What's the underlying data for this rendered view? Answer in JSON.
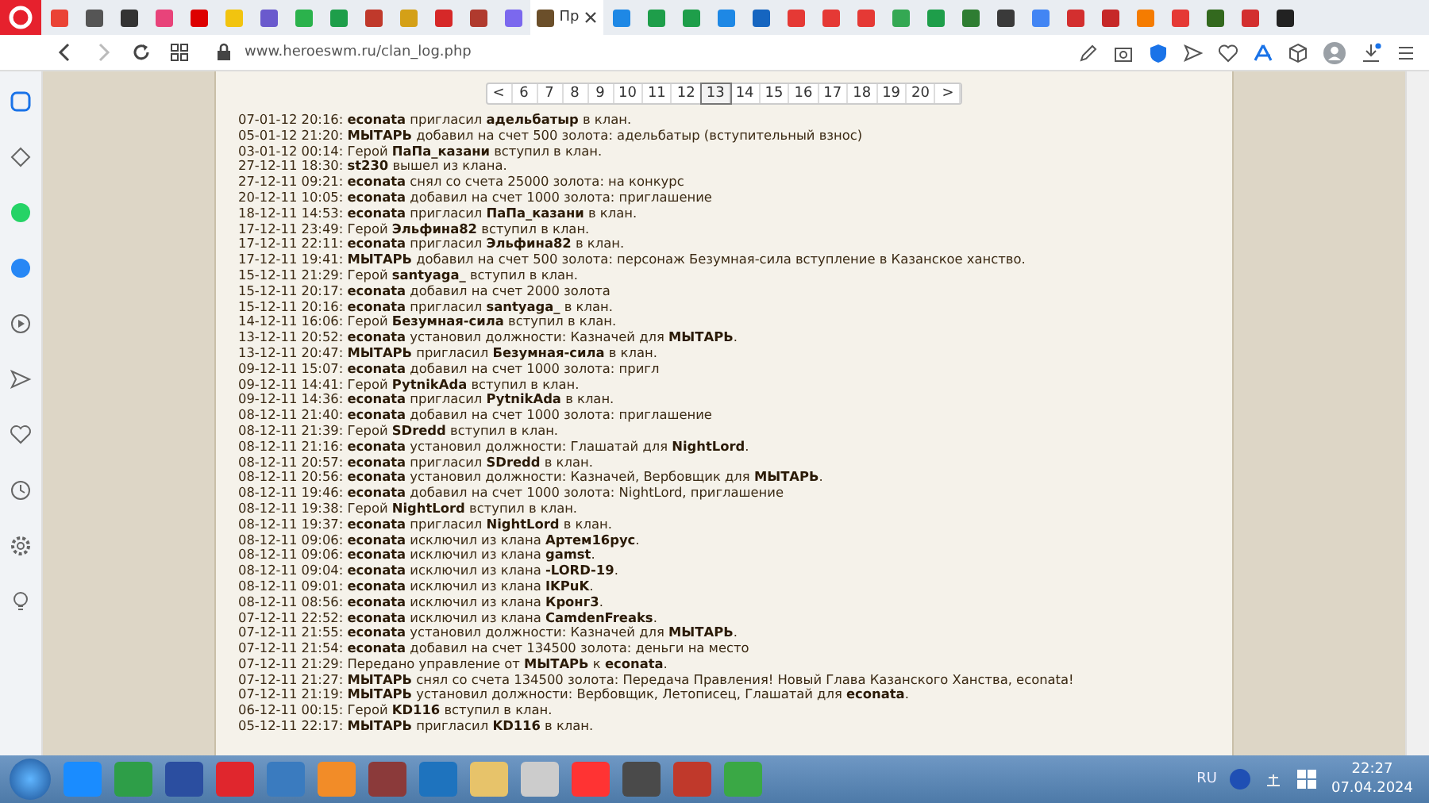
{
  "browser_tabs": [
    {
      "color": "#ea4335",
      "selected": false
    },
    {
      "color": "#555555",
      "selected": false
    },
    {
      "color": "#333333",
      "selected": false
    },
    {
      "color": "#e8437a",
      "selected": false
    },
    {
      "color": "#dd0000",
      "selected": false
    },
    {
      "color": "#f2c40f",
      "selected": false
    },
    {
      "color": "#6a5acd",
      "selected": false
    },
    {
      "color": "#2bb24c",
      "selected": false
    },
    {
      "color": "#1e9e4a",
      "selected": false
    },
    {
      "color": "#c0392b",
      "selected": false
    },
    {
      "color": "#d4a017",
      "selected": false
    },
    {
      "color": "#d62828",
      "selected": false
    },
    {
      "color": "#b03a2e",
      "selected": false
    },
    {
      "color": "#7b68ee",
      "selected": false
    },
    {
      "color": "#6b4f2a",
      "selected": true,
      "title": "Пр"
    },
    {
      "color": "#1e88e5",
      "selected": false
    },
    {
      "color": "#1e9e4a",
      "selected": false
    },
    {
      "color": "#1e9e4a",
      "selected": false
    },
    {
      "color": "#1e88e5",
      "selected": false
    },
    {
      "color": "#1565c0",
      "selected": false
    },
    {
      "color": "#e53935",
      "selected": false
    },
    {
      "color": "#e53935",
      "selected": false
    },
    {
      "color": "#e53935",
      "selected": false
    },
    {
      "color": "#34a853",
      "selected": false
    },
    {
      "color": "#1e9e4a",
      "selected": false
    },
    {
      "color": "#2e7d32",
      "selected": false
    },
    {
      "color": "#3a3a3a",
      "selected": false
    },
    {
      "color": "#4285f4",
      "selected": false
    },
    {
      "color": "#d32f2f",
      "selected": false
    },
    {
      "color": "#c62828",
      "selected": false
    },
    {
      "color": "#f57c00",
      "selected": false
    },
    {
      "color": "#e53935",
      "selected": false
    },
    {
      "color": "#33691e",
      "selected": false
    },
    {
      "color": "#d32f2f",
      "selected": false
    },
    {
      "color": "#222222",
      "selected": false
    }
  ],
  "address_bar": {
    "url": "www.heroeswm.ru/clan_log.php"
  },
  "pagination": [
    {
      "label": "<",
      "selected": false
    },
    {
      "label": "6",
      "selected": false
    },
    {
      "label": "7",
      "selected": false
    },
    {
      "label": "8",
      "selected": false
    },
    {
      "label": "9",
      "selected": false
    },
    {
      "label": "10",
      "selected": false
    },
    {
      "label": "11",
      "selected": false
    },
    {
      "label": "12",
      "selected": false
    },
    {
      "label": "13",
      "selected": true
    },
    {
      "label": "14",
      "selected": false
    },
    {
      "label": "15",
      "selected": false
    },
    {
      "label": "16",
      "selected": false
    },
    {
      "label": "17",
      "selected": false
    },
    {
      "label": "18",
      "selected": false
    },
    {
      "label": "19",
      "selected": false
    },
    {
      "label": "20",
      "selected": false
    },
    {
      "label": ">",
      "selected": false
    }
  ],
  "log": [
    "07-01-12 20:16: **econata** пригласил **адельбатыр** в клан.",
    "05-01-12 21:20: **МЫТАРЬ** добавил на счет 500 золота: адельбатыр (вступительный взнос)",
    "03-01-12 00:14: Герой **ПаПа_казани** вступил в клан.",
    "27-12-11 18:30: **st230** вышел из клана.",
    "27-12-11 09:21: **econata** снял со счета 25000 золота: на конкурс",
    "20-12-11 10:05: **econata** добавил на счет 1000 золота: приглашение",
    "18-12-11 14:53: **econata** пригласил **ПаПа_казани** в клан.",
    "17-12-11 23:49: Герой **Эльфина82** вступил в клан.",
    "17-12-11 22:11: **econata** пригласил **Эльфина82** в клан.",
    "17-12-11 19:41: **МЫТАРЬ** добавил на счет 500 золота: персонаж Безумная-сила вступление в Казанское ханство.",
    "15-12-11 21:29: Герой **santyaga_** вступил в клан.",
    "15-12-11 20:17: **econata** добавил на счет 2000 золота",
    "15-12-11 20:16: **econata** пригласил **santyaga_** в клан.",
    "14-12-11 16:06: Герой **Безумная-сила** вступил в клан.",
    "13-12-11 20:52: **econata** установил должности: Казначей для **МЫТАРЬ**.",
    "13-12-11 20:47: **МЫТАРЬ** пригласил **Безумная-сила** в клан.",
    "09-12-11 15:07: **econata** добавил на счет 1000 золота: пригл",
    "09-12-11 14:41: Герой **PytnikAda** вступил в клан.",
    "09-12-11 14:36: **econata** пригласил **PytnikAda** в клан.",
    "08-12-11 21:40: **econata** добавил на счет 1000 золота: приглашение",
    "08-12-11 21:39: Герой **SDredd** вступил в клан.",
    "08-12-11 21:16: **econata** установил должности: Глашатай для **NightLord**.",
    "08-12-11 20:57: **econata** пригласил **SDredd** в клан.",
    "08-12-11 20:56: **econata** установил должности: Казначей, Вербовщик для **МЫТАРЬ**.",
    "08-12-11 19:46: **econata** добавил на счет 1000 золота: NightLord, приглашение",
    "08-12-11 19:38: Герой **NightLord** вступил в клан.",
    "08-12-11 19:37: **econata** пригласил **NightLord** в клан.",
    "08-12-11 09:06: **econata** исключил из клана **Артем16рус**.",
    "08-12-11 09:06: **econata** исключил из клана **gamst**.",
    "08-12-11 09:04: **econata** исключил из клана **-LORD-19**.",
    "08-12-11 09:01: **econata** исключил из клана **IKPuK**.",
    "08-12-11 08:56: **econata** исключил из клана **Кронг3**.",
    "07-12-11 22:52: **econata** исключил из клана **CamdenFreaks**.",
    "07-12-11 21:55: **econata** установил должности: Казначей для **МЫТАРЬ**.",
    "07-12-11 21:54: **econata** добавил на счет 134500 золота: деньги на место",
    "07-12-11 21:29: Передано управление от **МЫТАРЬ** к **econata**.",
    "07-12-11 21:27: **МЫТАРЬ** снял со счета 134500 золота: Передача Правления! Новый Глава Казанского Ханства, econata!",
    "07-12-11 21:19: **МЫТАРЬ** установил должности: Вербовщик, Летописец, Глашатай для **econata**.",
    "06-12-11 00:15: Герой **KD116** вступил в клан.",
    "05-12-11 22:17: **МЫТАРЬ** пригласил **KD116** в клан."
  ],
  "taskbar": {
    "apps": [
      {
        "color": "#1a8cff"
      },
      {
        "color": "#2e9e48"
      },
      {
        "color": "#2b4ea0"
      },
      {
        "color": "#e0262d"
      },
      {
        "color": "#3a7bbf"
      },
      {
        "color": "#f28c28"
      },
      {
        "color": "#8b3a3a"
      },
      {
        "color": "#1e73be"
      },
      {
        "color": "#e7c36a"
      },
      {
        "color": "#cccccc"
      },
      {
        "color": "#ff3333"
      },
      {
        "color": "#4a4a4a"
      },
      {
        "color": "#c0392b"
      },
      {
        "color": "#3aa845"
      }
    ],
    "language": "RU",
    "time": "22:27",
    "date": "07.04.2024"
  }
}
